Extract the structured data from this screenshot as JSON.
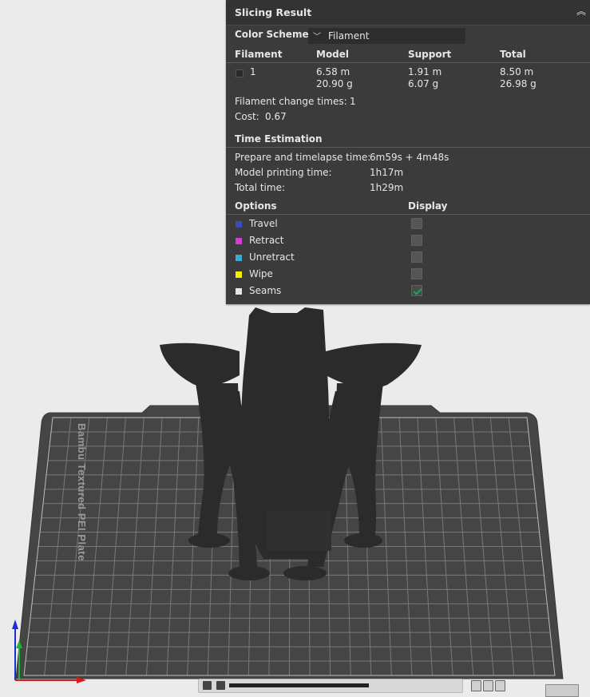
{
  "panel": {
    "title": "Slicing Result",
    "color_scheme_label": "Color Scheme",
    "color_scheme_value": "Filament",
    "table_headers": [
      "Filament",
      "Model",
      "Support",
      "Total"
    ],
    "filament_row": {
      "index": "1",
      "model_length": "6.58 m",
      "model_weight": "20.90 g",
      "support_length": "1.91 m",
      "support_weight": "6.07 g",
      "total_length": "8.50 m",
      "total_weight": "26.98 g"
    },
    "filament_change_label": "Filament change times:",
    "filament_change_value": "1",
    "cost_label": "Cost:",
    "cost_value": "0.67",
    "time_header": "Time Estimation",
    "times": [
      {
        "label": "Prepare and timelapse time:",
        "value": "6m59s + 4m48s"
      },
      {
        "label": "Model printing time:",
        "value": "1h17m"
      },
      {
        "label": "Total time:",
        "value": "1h29m"
      }
    ],
    "options_header": "Options",
    "display_header": "Display",
    "options": [
      {
        "label": "Travel",
        "color": "#3b4dbd",
        "checked": false
      },
      {
        "label": "Retract",
        "color": "#d43fd4",
        "checked": false
      },
      {
        "label": "Unretract",
        "color": "#3fa8d6",
        "checked": false
      },
      {
        "label": "Wipe",
        "color": "#f0f000",
        "checked": false
      },
      {
        "label": "Seams",
        "color": "#e6e6e6",
        "checked": true
      }
    ]
  },
  "plate": {
    "label": "Bambu Textured PEI Plate"
  },
  "colors": {
    "plate": "#454545",
    "grid": "#8a8a8a",
    "model": "#2b2b2b",
    "panel_bg": "#3b3b3b",
    "check_green": "#19a45a"
  }
}
